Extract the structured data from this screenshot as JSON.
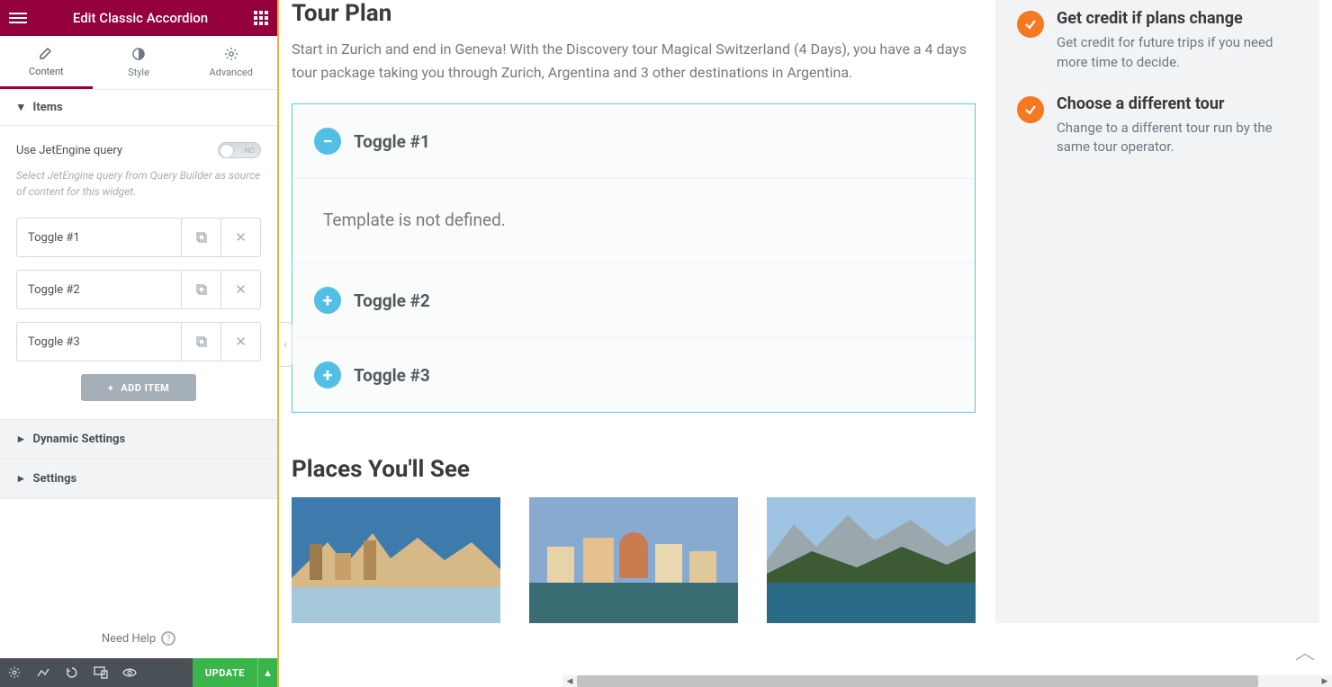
{
  "sidebar": {
    "title": "Edit Classic Accordion",
    "tabs": {
      "content": "Content",
      "style": "Style",
      "advanced": "Advanced"
    },
    "section_items": "Items",
    "jetengine_label": "Use JetEngine query",
    "jetengine_toggle": "NO",
    "jetengine_hint": "Select JetEngine query from Query Builder as source of content for this widget.",
    "items": [
      {
        "label": "Toggle #1"
      },
      {
        "label": "Toggle #2"
      },
      {
        "label": "Toggle #3"
      }
    ],
    "add_item": "ADD ITEM",
    "dynamic_settings": "Dynamic Settings",
    "settings": "Settings",
    "need_help": "Need Help",
    "update": "UPDATE"
  },
  "page": {
    "tour_plan_title": "Tour Plan",
    "intro": "Start in Zurich and end in Geneva! With the Discovery tour Magical Switzerland (4 Days), you have a 4 days tour package taking you through Zurich, Argentina and 3 other destinations in Argentina.",
    "accordion": [
      {
        "title": "Toggle #1",
        "body": "Template is not defined.",
        "open": true
      },
      {
        "title": "Toggle #2",
        "open": false
      },
      {
        "title": "Toggle #3",
        "open": false
      }
    ],
    "places_title": "Places You'll See"
  },
  "benefits": [
    {
      "title": "Get credit if plans change",
      "text": "Get credit for future trips if you need more time to decide."
    },
    {
      "title": "Choose a different tour",
      "text": "Change to a different tour run by the same tour operator."
    }
  ]
}
